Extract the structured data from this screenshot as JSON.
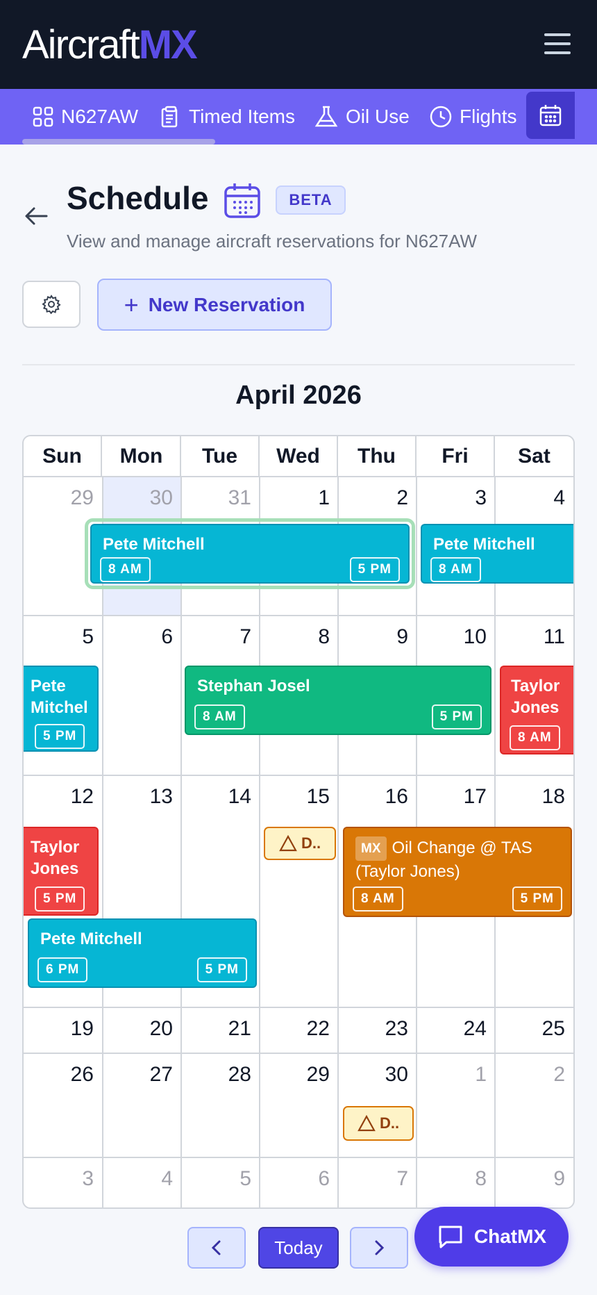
{
  "header": {
    "logo_text": "Aircraft",
    "logo_accent": "MX"
  },
  "tabs": [
    {
      "label": "N627AW"
    },
    {
      "label": "Timed Items"
    },
    {
      "label": "Oil Use"
    },
    {
      "label": "Flights"
    }
  ],
  "page": {
    "title": "Schedule",
    "badge": "BETA",
    "subtitle": "View and manage aircraft reservations for N627AW",
    "new_reservation_label": "New Reservation"
  },
  "calendar": {
    "month_label": "April 2026",
    "weekdays": [
      "Sun",
      "Mon",
      "Tue",
      "Wed",
      "Thu",
      "Fri",
      "Sat"
    ],
    "weeks": [
      [
        "29",
        "30",
        "31",
        "1",
        "2",
        "3",
        "4"
      ],
      [
        "5",
        "6",
        "7",
        "8",
        "9",
        "10",
        "11"
      ],
      [
        "12",
        "13",
        "14",
        "15",
        "16",
        "17",
        "18"
      ],
      [
        "19",
        "20",
        "21",
        "22",
        "23",
        "24",
        "25"
      ],
      [
        "26",
        "27",
        "28",
        "29",
        "30",
        "1",
        "2"
      ],
      [
        "3",
        "4",
        "5",
        "6",
        "7",
        "8",
        "9"
      ]
    ],
    "events": [
      {
        "name": "Pete Mitchell",
        "start": "8 AM",
        "end": "5 PM",
        "color": "#06b6d4"
      },
      {
        "name": "Pete Mitchell",
        "start": "8 AM",
        "color": "#06b6d4"
      },
      {
        "name": "Pete Mitchel",
        "end": "5 PM",
        "color": "#06b6d4"
      },
      {
        "name": "Stephan Josel",
        "start": "8 AM",
        "end": "5 PM",
        "color": "#10b981"
      },
      {
        "name": "Taylor Jones",
        "start": "8 AM",
        "color": "#ef4444"
      },
      {
        "name": "Taylor Jones",
        "end": "5 PM",
        "color": "#ef4444"
      },
      {
        "name": "Pete Mitchell",
        "start": "6 PM",
        "end": "5 PM",
        "color": "#06b6d4"
      },
      {
        "tag": "MX",
        "name": "Oil Change @ TAS (Taylor Jones)",
        "start": "8 AM",
        "end": "5 PM",
        "color": "#d97706"
      }
    ],
    "warnings": [
      {
        "label": "D..",
        "icon": "warning-triangle-icon"
      },
      {
        "label": "D..",
        "icon": "warning-triangle-icon"
      }
    ]
  },
  "footer": {
    "today_label": "Today",
    "chat_label": "ChatMX"
  }
}
